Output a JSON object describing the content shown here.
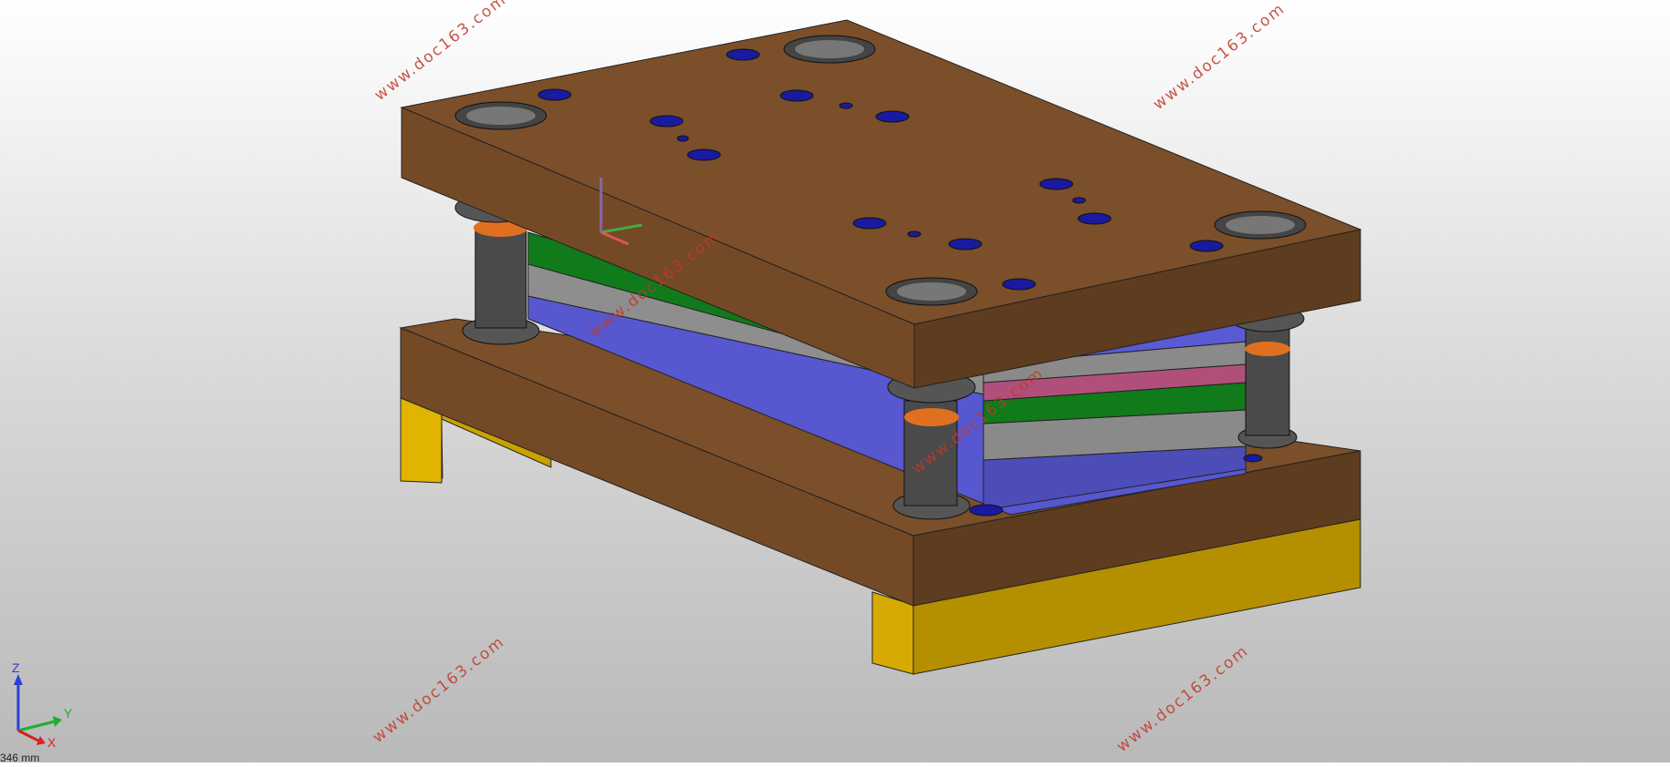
{
  "watermark": {
    "text_1": "www.doc163.com",
    "text_2": "www.doc163.com",
    "text_3": "www.doc163.com",
    "text_4": "www.doc163.com",
    "text_5": "www.doc163.com",
    "text_6": "www.doc163.com",
    "color": "#c0392b"
  },
  "triad": {
    "z_label": "Z",
    "y_label": "Y",
    "x_label": "X",
    "z_color": "#2a3fd6",
    "y_color": "#1fae2f",
    "x_color": "#d62020"
  },
  "status": {
    "scale_text": "346 mm"
  },
  "colors": {
    "plate_brown": "#7a4f2a",
    "plate_brown_dark": "#5e3c1f",
    "parallel_yellow": "#d4a800",
    "green_plate": "#117a1a",
    "grey_plate": "#8a8a8a",
    "blue_plate": "#5757d0",
    "pink_plate": "#b0507a",
    "hole_blue": "#1a1aa0"
  }
}
